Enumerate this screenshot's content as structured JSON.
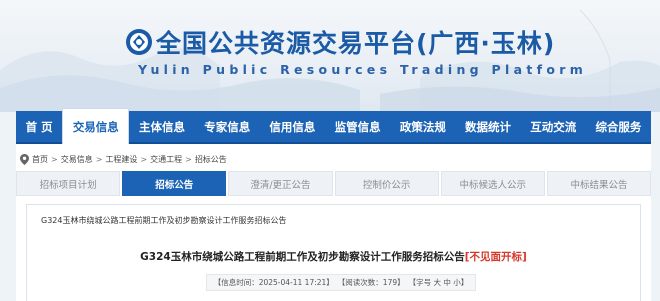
{
  "header": {
    "title": "全国公共资源交易平台(广西·玉林)",
    "subtitle": "Yulin Public Resources Trading Platform"
  },
  "nav": {
    "items": [
      {
        "label": "首 页"
      },
      {
        "label": "交易信息",
        "active": true
      },
      {
        "label": "主体信息"
      },
      {
        "label": "专家信息"
      },
      {
        "label": "信用信息"
      },
      {
        "label": "监管信息"
      },
      {
        "label": "政策法规"
      },
      {
        "label": "数据统计"
      },
      {
        "label": "互动交流"
      },
      {
        "label": "综合服务"
      }
    ]
  },
  "breadcrumb": {
    "items": [
      "首页",
      "交易信息",
      "工程建设",
      "交通工程",
      "招标公告"
    ],
    "separator": ">"
  },
  "tabs": [
    {
      "label": "招标项目计划"
    },
    {
      "label": "招标公告",
      "active": true
    },
    {
      "label": "澄清/更正公告"
    },
    {
      "label": "控制价公示"
    },
    {
      "label": "中标候选人公示"
    },
    {
      "label": "中标结果公告"
    }
  ],
  "document": {
    "small_title": "G324玉林市绕城公路工程前期工作及初步勘察设计工作服务招标公告",
    "title": "G324玉林市绕城公路工程前期工作及初步勘察设计工作服务招标公告",
    "tag": "[不见面开标]",
    "meta": {
      "date_label": "【信息时间：",
      "date": "2025-04-11 17:21",
      "date_close": "】",
      "views_label": "【阅读次数：",
      "views": "179",
      "views_close": "】",
      "font_label": "【字号",
      "font_large": "大",
      "font_medium": "中",
      "font_small": "小",
      "font_close": "】"
    }
  },
  "colors": {
    "brand_blue": "#1c63b6",
    "title_blue": "#1a5aa6",
    "tag_red": "#d6372a"
  }
}
